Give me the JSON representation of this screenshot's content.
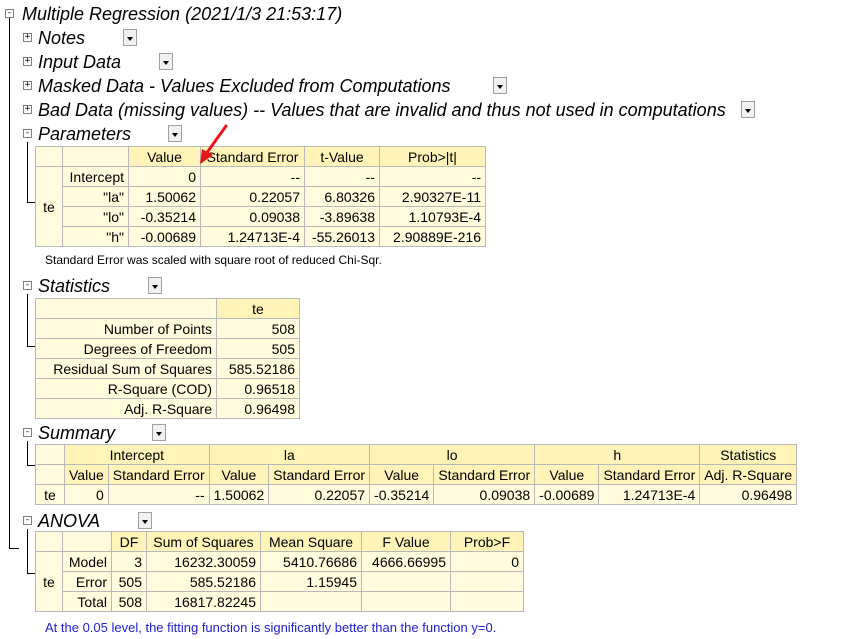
{
  "report": {
    "title": "Multiple Regression (2021/1/3 21:53:17)",
    "sections": {
      "notes": "Notes",
      "input_data": "Input Data",
      "masked_data": "Masked Data - Values Excluded from Computations",
      "bad_data": "Bad Data (missing values) -- Values that are invalid and thus not used in computations",
      "parameters": "Parameters",
      "statistics": "Statistics",
      "summary": "Summary",
      "anova": "ANOVA"
    },
    "expand_symbol": "+",
    "collapse_symbol": "-"
  },
  "parameters": {
    "group": "te",
    "headers": [
      "Value",
      "Standard Error",
      "t-Value",
      "Prob>|t|"
    ],
    "rows": [
      {
        "name": "Intercept",
        "value": "0",
        "se": "--",
        "t": "--",
        "p": "--"
      },
      {
        "name": "\"la\"",
        "value": "1.50062",
        "se": "0.22057",
        "t": "6.80326",
        "p": "2.90327E-11"
      },
      {
        "name": "\"lo\"",
        "value": "-0.35214",
        "se": "0.09038",
        "t": "-3.89638",
        "p": "1.10793E-4"
      },
      {
        "name": "\"h\"",
        "value": "-0.00689",
        "se": "1.24713E-4",
        "t": "-55.26013",
        "p": "2.90889E-216"
      }
    ],
    "note": "Standard Error was scaled with square root of reduced Chi-Sqr."
  },
  "statistics": {
    "column": "te",
    "rows": [
      {
        "label": "Number of Points",
        "value": "508"
      },
      {
        "label": "Degrees of Freedom",
        "value": "505"
      },
      {
        "label": "Residual Sum of Squares",
        "value": "585.52186"
      },
      {
        "label": "R-Square (COD)",
        "value": "0.96518"
      },
      {
        "label": "Adj. R-Square",
        "value": "0.96498"
      }
    ]
  },
  "summary": {
    "groups": [
      "Intercept",
      "la",
      "lo",
      "h",
      "Statistics"
    ],
    "subheaders": [
      "Value",
      "Standard Error",
      "Value",
      "Standard Error",
      "Value",
      "Standard Error",
      "Value",
      "Standard Error",
      "Adj. R-Square"
    ],
    "row_label": "te",
    "values": [
      "0",
      "--",
      "1.50062",
      "0.22057",
      "-0.35214",
      "0.09038",
      "-0.00689",
      "1.24713E-4",
      "0.96498"
    ]
  },
  "anova": {
    "group": "te",
    "headers": [
      "DF",
      "Sum of Squares",
      "Mean Square",
      "F Value",
      "Prob>F"
    ],
    "rows": [
      {
        "name": "Model",
        "df": "3",
        "ss": "16232.30059",
        "ms": "5410.76686",
        "f": "4666.66995",
        "p": "0"
      },
      {
        "name": "Error",
        "df": "505",
        "ss": "585.52186",
        "ms": "1.15945",
        "f": "",
        "p": ""
      },
      {
        "name": "Total",
        "df": "508",
        "ss": "16817.82245",
        "ms": "",
        "f": "",
        "p": ""
      }
    ],
    "note": "At the 0.05 level, the fitting function is significantly better than the function y=0."
  },
  "colors": {
    "table_bg": "#fffbdc",
    "header_bg": "#fff3b8",
    "note_blue": "#1d1dd6",
    "annotation_arrow": "#e8141a"
  }
}
